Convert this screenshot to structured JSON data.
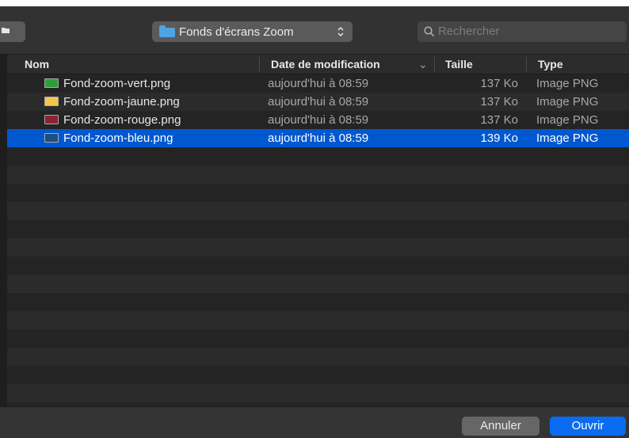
{
  "toolbar": {
    "location_label": "Fonds d'écrans Zoom",
    "search_placeholder": "Rechercher"
  },
  "columns": {
    "name": "Nom",
    "date": "Date de modification",
    "size": "Taille",
    "type": "Type"
  },
  "files": [
    {
      "name": "Fond-zoom-vert.png",
      "date": "aujourd'hui à 08:59",
      "size": "137 Ko",
      "type": "Image PNG",
      "icon_color": "#2f9e3a"
    },
    {
      "name": "Fond-zoom-jaune.png",
      "date": "aujourd'hui à 08:59",
      "size": "137 Ko",
      "type": "Image PNG",
      "icon_color": "#f2c84b"
    },
    {
      "name": "Fond-zoom-rouge.png",
      "date": "aujourd'hui à 08:59",
      "size": "137 Ko",
      "type": "Image PNG",
      "icon_color": "#8a2430"
    },
    {
      "name": "Fond-zoom-bleu.png",
      "date": "aujourd'hui à 08:59",
      "size": "139 Ko",
      "type": "Image PNG",
      "icon_color": "#1f4f7a",
      "selected": true
    }
  ],
  "buttons": {
    "cancel": "Annuler",
    "open": "Ouvrir"
  },
  "colors": {
    "selection": "#0058d0",
    "primary_button": "#0a6cf0",
    "folder": "#4fa3e3"
  }
}
